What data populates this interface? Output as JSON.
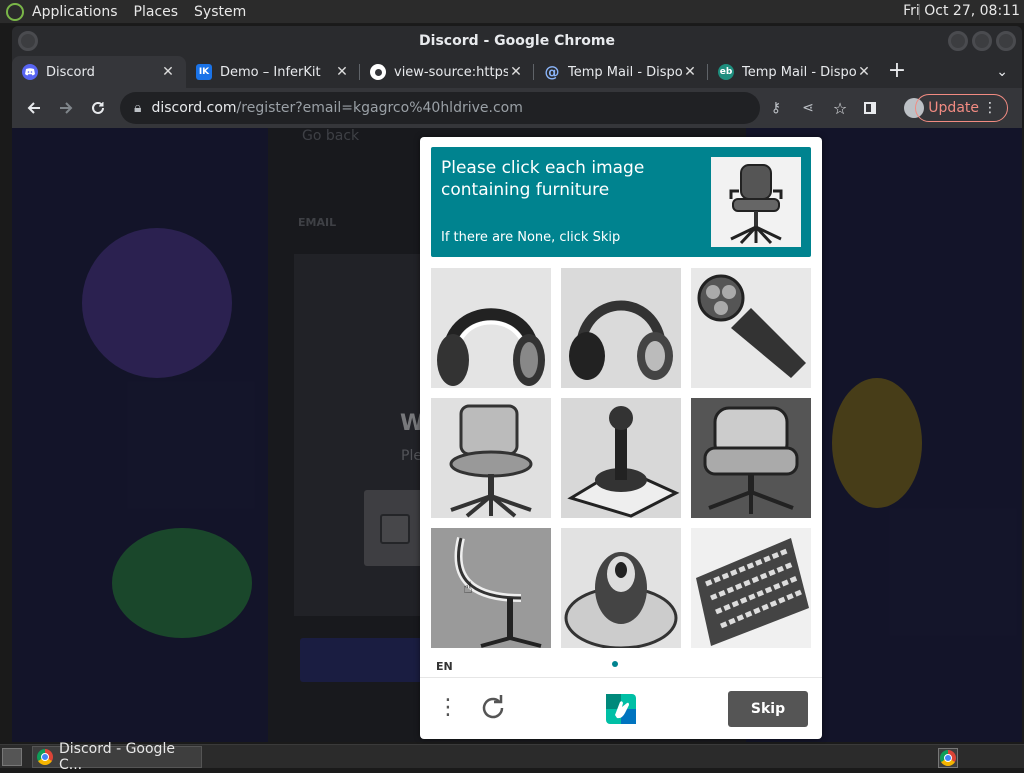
{
  "panel": {
    "menus": [
      "Applications",
      "Places",
      "System"
    ],
    "clock": "Fri Oct 27, 08:11"
  },
  "window": {
    "title": "Discord - Google Chrome"
  },
  "tabs": [
    {
      "label": "Discord",
      "favicon": "discord-icon",
      "color": "#5865f2",
      "active": true
    },
    {
      "label": "Demo – InferKit",
      "favicon": "inferkit-icon",
      "favicon_text": "IK",
      "color": "#1a73e8",
      "active": false
    },
    {
      "label": "view-source:https:",
      "favicon": "chromium-icon",
      "color": "#ffffff",
      "active": false
    },
    {
      "label": "Temp Mail - Dispos",
      "favicon": "at-icon",
      "color": "#8ab4f8",
      "active": false
    },
    {
      "label": "Temp Mail - Dispos",
      "favicon": "tempmail-icon",
      "favicon_text": "eb",
      "color": "#1e8e7e",
      "active": false
    }
  ],
  "toolbar": {
    "url_host": "discord.com",
    "url_path": "/register?email=kgagrco%40hldrive.com",
    "update_label": "Update"
  },
  "discord_page": {
    "back_link": "Go back",
    "email_label": "EMAIL",
    "welcome_title": "W",
    "welcome_sub": "Ple"
  },
  "captcha": {
    "prompt": "Please click each image containing furniture",
    "sub_prompt": "If there are None, click Skip",
    "language": "EN",
    "skip_label": "Skip",
    "tiles": [
      {
        "subject": "headphones"
      },
      {
        "subject": "headphones"
      },
      {
        "subject": "electric shaver"
      },
      {
        "subject": "office chair"
      },
      {
        "subject": "joystick"
      },
      {
        "subject": "armchair"
      },
      {
        "subject": "office chair"
      },
      {
        "subject": "joystick"
      },
      {
        "subject": "keyboard"
      }
    ],
    "accent": "#00838f"
  },
  "taskbar": {
    "task_label": "Discord - Google C..."
  }
}
